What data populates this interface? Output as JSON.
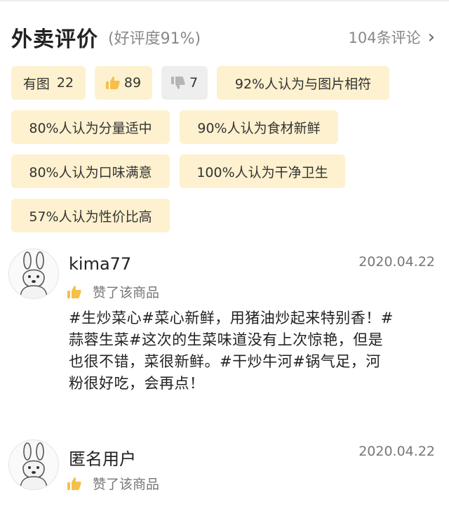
{
  "header": {
    "title": "外卖评价",
    "subtitle": "(好评度91%)",
    "count_label": "104条评论"
  },
  "tags": {
    "has_image_label": "有图",
    "has_image_count": "22",
    "thumbs_up_count": "89",
    "thumbs_down_count": "7",
    "items": [
      "92%人认为与图片相符",
      "80%人认为分量适中",
      "90%人认为食材新鲜",
      "80%人认为口味满意",
      "100%人认为干净卫生",
      "57%人认为性价比高"
    ]
  },
  "reviews": [
    {
      "username": "kima77",
      "date": "2020.04.22",
      "like_text": "赞了该商品",
      "lines": [
        "#生炒菜心#菜心新鲜，用猪油炒起来特别香！#",
        "蒜蓉生菜#这次的生菜味道没有上次惊艳，但是",
        "也很不错，菜很新鲜。#干炒牛河#锅气足，河",
        "粉很好吃，会再点！"
      ]
    },
    {
      "username": "匿名用户",
      "date": "2020.04.22",
      "like_text": "赞了该商品"
    }
  ],
  "colors": {
    "tag_bg": "#fdf1cf",
    "tag_grey_bg": "#eeeeee",
    "thumb_up": "#f5c04a",
    "thumb_down": "#b5b5b5"
  },
  "icons": [
    "chevron-right-icon",
    "thumbs-up-icon",
    "thumbs-down-icon",
    "kangaroo-avatar"
  ]
}
